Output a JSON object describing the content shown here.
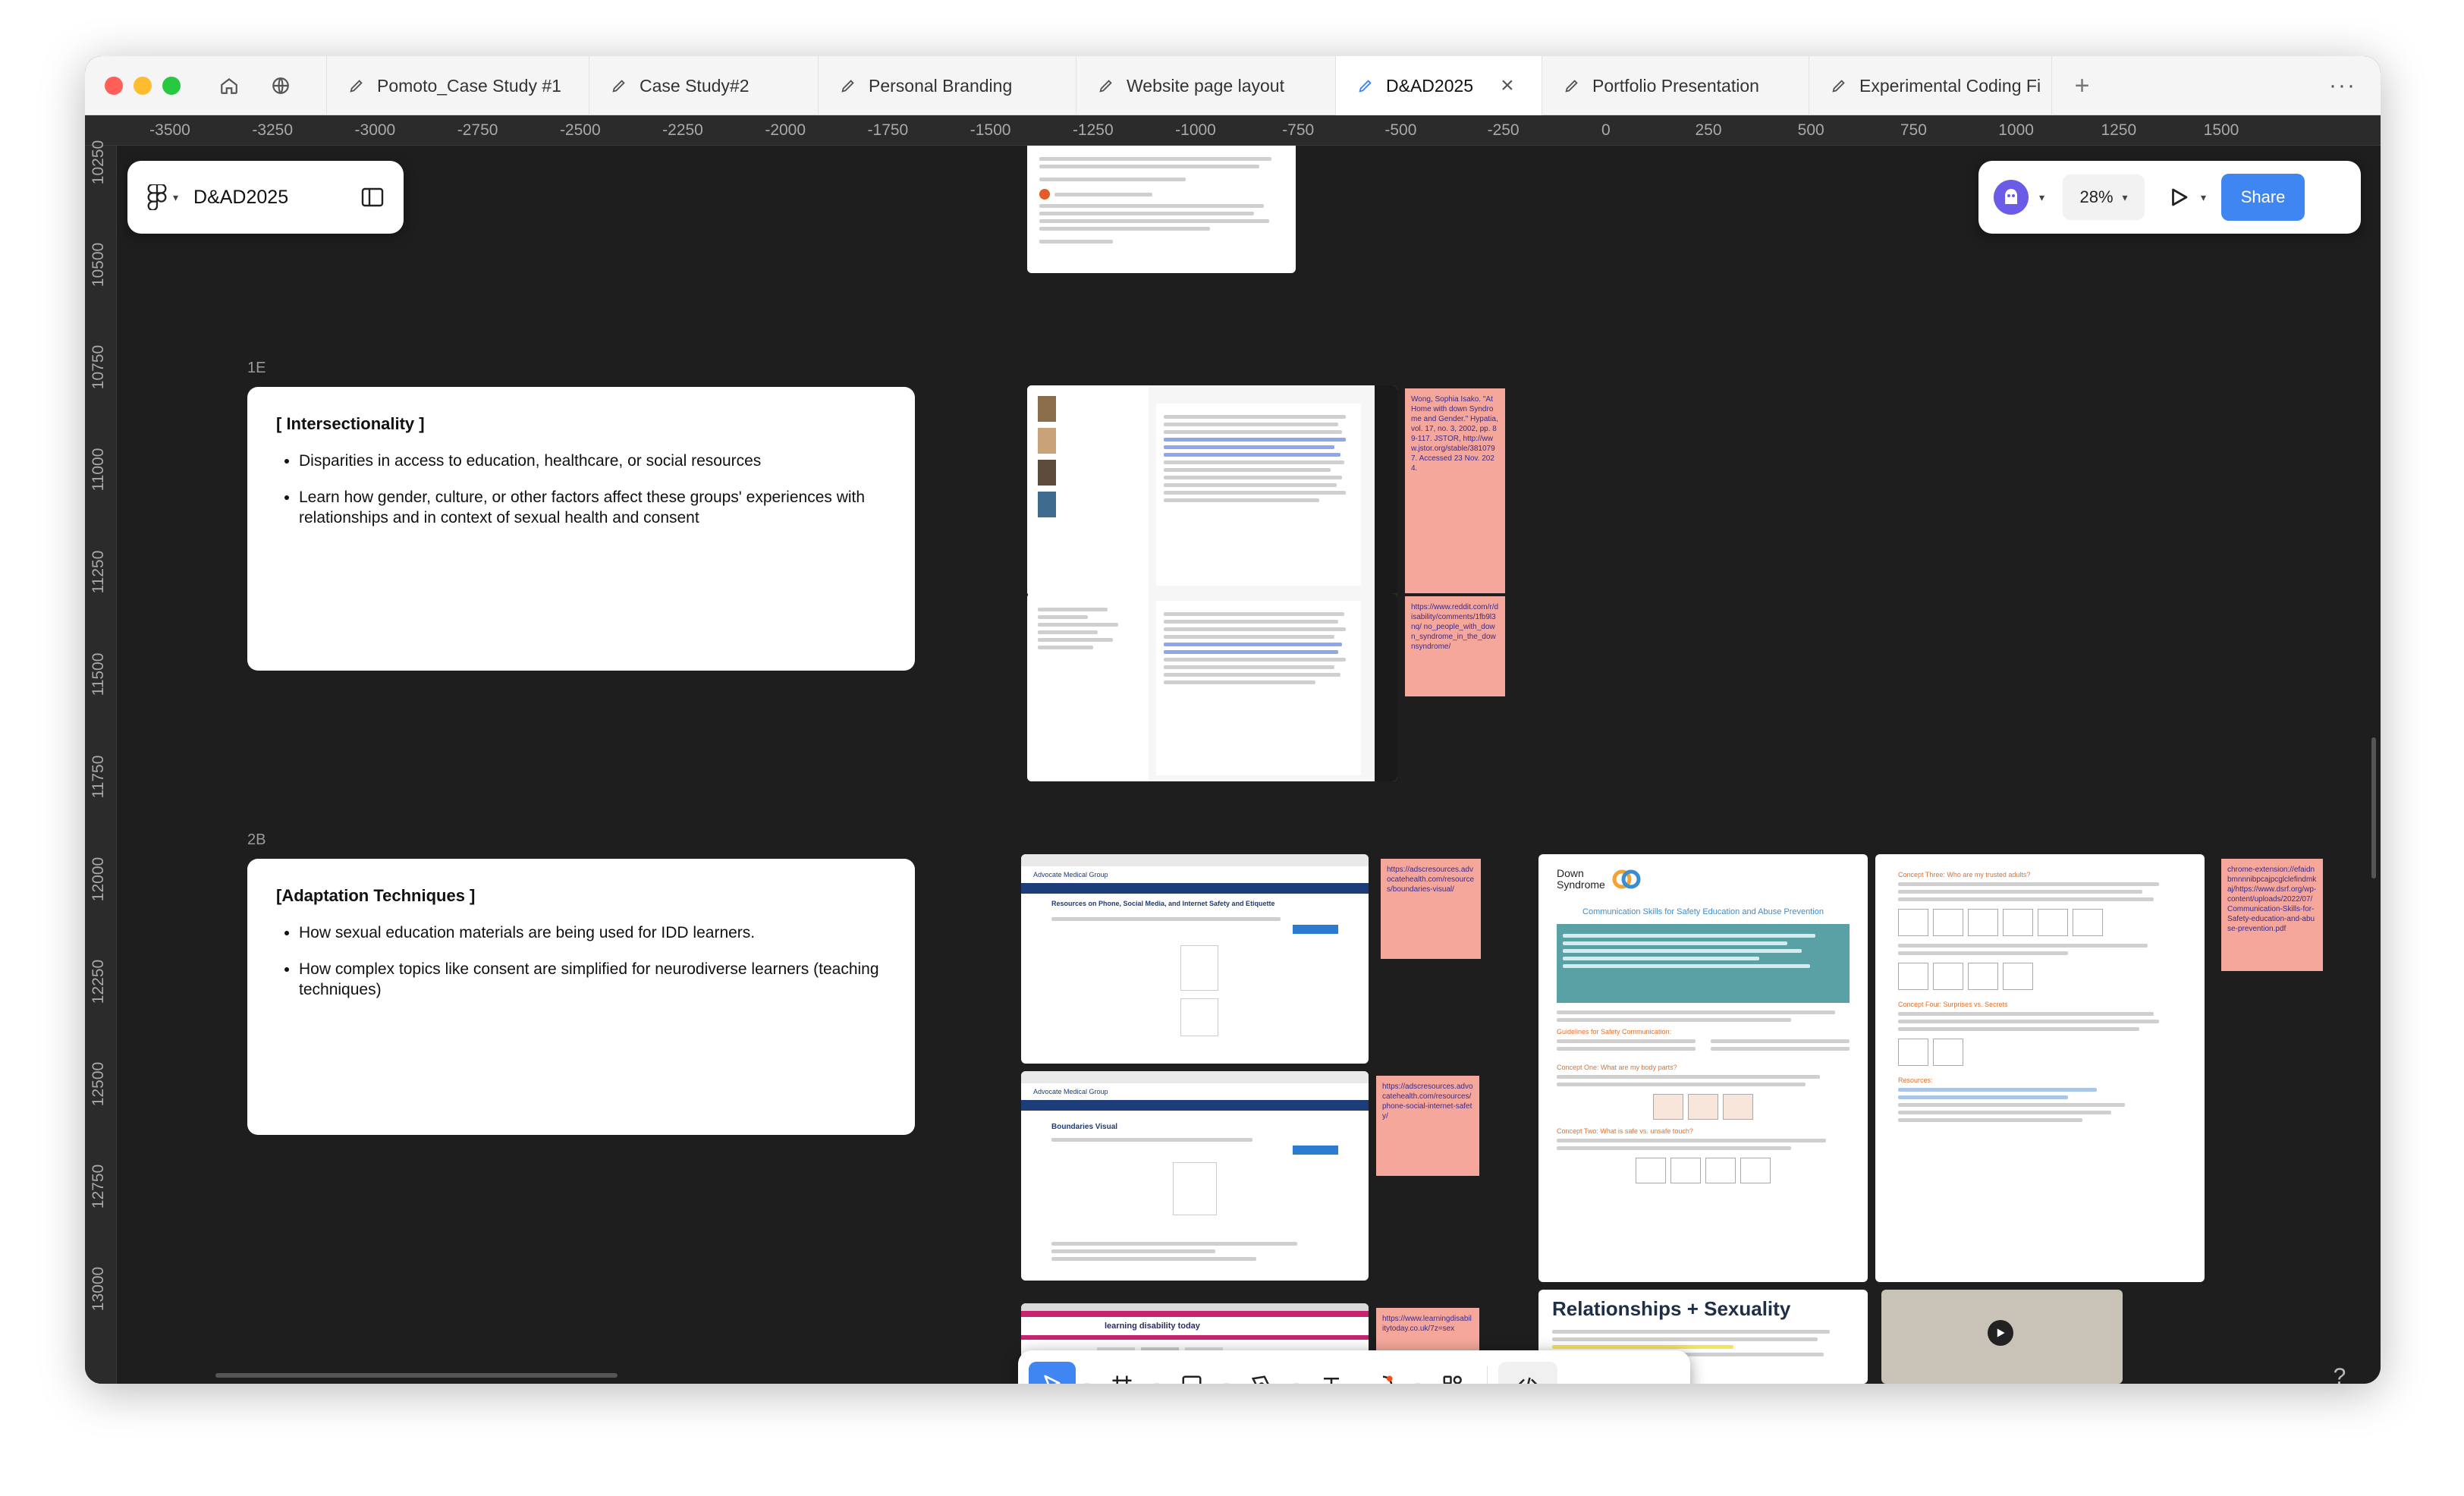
{
  "tabs": {
    "items": [
      "Pomoto_Case Study #1",
      "Case Study#2",
      "Personal Branding",
      "Website page layout",
      "D&AD2025",
      "Portfolio Presentation",
      "Experimental Coding Fi"
    ],
    "active": "D&AD2025"
  },
  "ruler": {
    "top": [
      "-3500",
      "-3250",
      "-3000",
      "-2750",
      "-2500",
      "-2250",
      "-2000",
      "-1750",
      "-1500",
      "-1250",
      "-1000",
      "-750",
      "-500",
      "-250",
      "0",
      "250",
      "500",
      "750",
      "1000",
      "1250",
      "1500"
    ],
    "left": [
      "10250",
      "10500",
      "10750",
      "11000",
      "11250",
      "11500",
      "11750",
      "12000",
      "12250",
      "12500",
      "12750",
      "13000"
    ]
  },
  "file_panel": {
    "title": "D&AD2025"
  },
  "right_panel": {
    "zoom": "28%",
    "share_label": "Share",
    "accent_color": "#3f86f2"
  },
  "sections": {
    "s1": {
      "label": "1E",
      "heading": "[ Intersectionality ]",
      "bullets": [
        "Disparities in access to education, healthcare, or social resources",
        "Learn how gender, culture, or other factors affect these groups' experiences with relationships and in context of sexual health and consent"
      ]
    },
    "s2": {
      "label": "2B",
      "heading": "[Adaptation Techniques ]",
      "bullets": [
        "How sexual education materials are being used for IDD learners.",
        "How complex topics like consent are simplified for neurodiverse learners (teaching techniques)"
      ]
    }
  },
  "stickies": [
    "Wong, Sophia Isako. \"At Home with down Syndrome and Gender.\" Hypatia, vol. 17, no. 3, 2002, pp. 89-117. JSTOR, http://www.jstor.org/stable/3810797. Accessed 23 Nov. 2024.",
    "https://www.reddit.com/r/disability/comments/1fb9l3nq/ no_people_with_down_syndrome_in_the_downsyndrome/",
    "https://adscresources.advocatehealth.com/resources/boundaries-visual/",
    "https://adscresources.advocatehealth.com/resources/phone-social-internet-safety/",
    "https://www.learningdisabilitytoday.co.uk/7z=sex",
    "chrome-extension://efaidnbmnnnibpcajpcglclefindmkaj/https://www.dsrf.org/wp-content/uploads/2022/07/Communication-Skills-for-Safety-education-and-abuse-prevention.pdf"
  ],
  "ds_doc": {
    "brand_line1": "Down",
    "brand_line2": "Syndrome",
    "title": "Communication Skills for Safety Education and Abuse Prevention",
    "heading_guidelines": "Guidelines for Safety Communication:",
    "heading_concept1": "Concept One: What are my body parts?",
    "heading_concept2": "Concept Two: What is safe vs. unsafe touch?"
  },
  "ds_doc2": {
    "heading_concept3": "Concept Three: Who are my trusted adults?",
    "heading_concept4": "Concept Four: Surprises vs. Secrets",
    "heading_resources": "Resources:"
  },
  "relationships_card": {
    "title": "Relationships + Sexuality"
  },
  "web_shot": {
    "org": "Advocate Medical Group",
    "heading1": "Resources on Phone, Social Media, and Internet Safety and Etiquette",
    "heading2": "Boundaries Visual",
    "ld_title": "learning disability today"
  },
  "help": "?"
}
